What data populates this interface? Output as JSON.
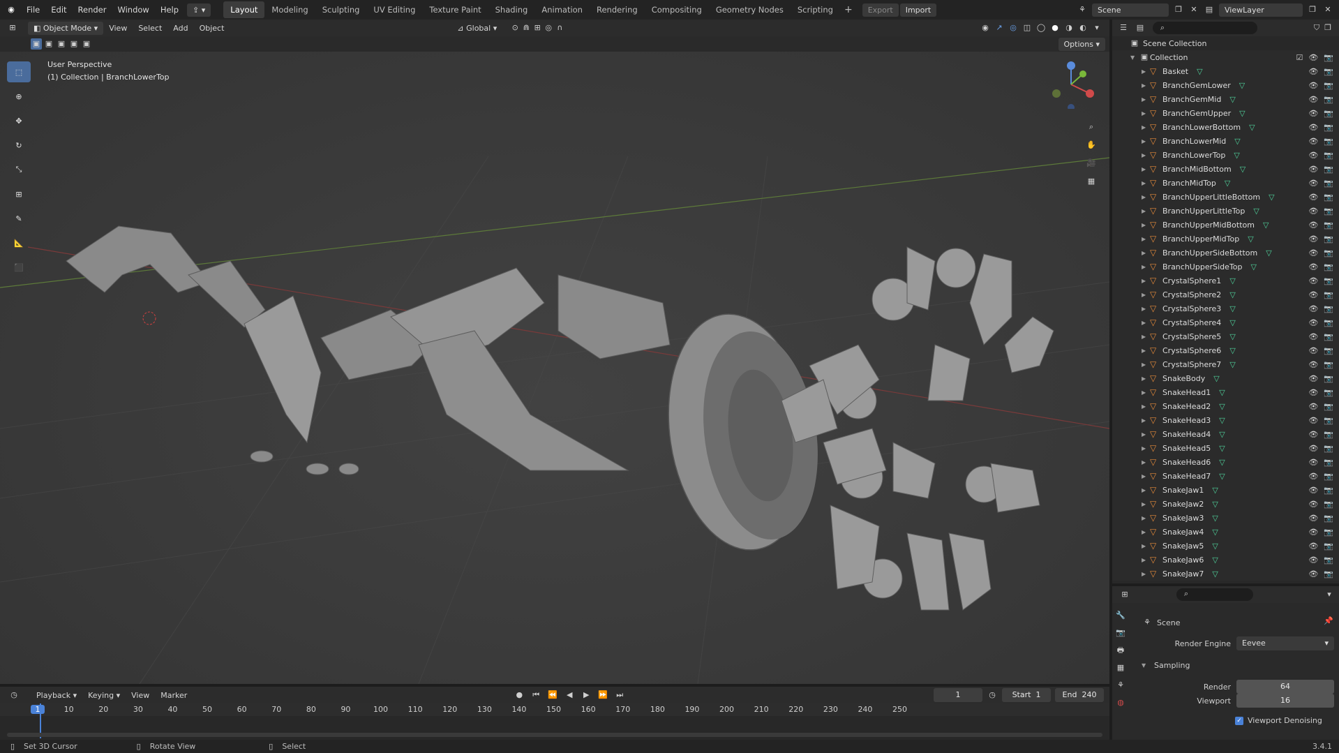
{
  "menubar": {
    "items": [
      "File",
      "Edit",
      "Render",
      "Window",
      "Help"
    ]
  },
  "workspaces": [
    "Layout",
    "Modeling",
    "Sculpting",
    "UV Editing",
    "Texture Paint",
    "Shading",
    "Animation",
    "Rendering",
    "Compositing",
    "Geometry Nodes",
    "Scripting"
  ],
  "export_label": "Export",
  "import_label": "Import",
  "scene_name": "Scene",
  "viewlayer_name": "ViewLayer",
  "viewport_header": {
    "mode": "Object Mode",
    "menus": [
      "View",
      "Select",
      "Add",
      "Object"
    ],
    "orientation": "Global",
    "options": "Options"
  },
  "viewport_overlay": {
    "perspective": "User Perspective",
    "collection_info": "(1) Collection | BranchLowerTop"
  },
  "outliner": {
    "root": "Scene Collection",
    "collection": "Collection",
    "objects": [
      "Basket",
      "BranchGemLower",
      "BranchGemMid",
      "BranchGemUpper",
      "BranchLowerBottom",
      "BranchLowerMid",
      "BranchLowerTop",
      "BranchMidBottom",
      "BranchMidTop",
      "BranchUpperLittleBottom",
      "BranchUpperLittleTop",
      "BranchUpperMidBottom",
      "BranchUpperMidTop",
      "BranchUpperSideBottom",
      "BranchUpperSideTop",
      "CrystalSphere1",
      "CrystalSphere2",
      "CrystalSphere3",
      "CrystalSphere4",
      "CrystalSphere5",
      "CrystalSphere6",
      "CrystalSphere7",
      "SnakeBody",
      "SnakeHead1",
      "SnakeHead2",
      "SnakeHead3",
      "SnakeHead4",
      "SnakeHead5",
      "SnakeHead6",
      "SnakeHead7",
      "SnakeJaw1",
      "SnakeJaw2",
      "SnakeJaw3",
      "SnakeJaw4",
      "SnakeJaw5",
      "SnakeJaw6",
      "SnakeJaw7"
    ]
  },
  "properties": {
    "context": "Scene",
    "render_engine_label": "Render Engine",
    "render_engine": "Eevee",
    "sampling_label": "Sampling",
    "render_label": "Render",
    "render_value": "64",
    "viewport_label": "Viewport",
    "viewport_value": "16",
    "denoise_label": "Viewport Denoising"
  },
  "timeline": {
    "menus": [
      "Playback",
      "Keying",
      "View",
      "Marker"
    ],
    "current_frame": "1",
    "start_label": "Start",
    "start": "1",
    "end_label": "End",
    "end": "240",
    "ticks": [
      "1",
      "10",
      "20",
      "30",
      "40",
      "50",
      "60",
      "70",
      "80",
      "90",
      "100",
      "110",
      "120",
      "130",
      "140",
      "150",
      "160",
      "170",
      "180",
      "190",
      "200",
      "210",
      "220",
      "230",
      "240",
      "250"
    ]
  },
  "statusbar": {
    "left": "Set 3D Cursor",
    "mid": "Rotate View",
    "right": "Select",
    "version": "3.4.1"
  },
  "colors": {
    "accent": "#4a6c9c",
    "active_frame": "#4a82d8",
    "mesh_icon": "#e58a3a",
    "vertex_icon": "#4fd39c"
  }
}
